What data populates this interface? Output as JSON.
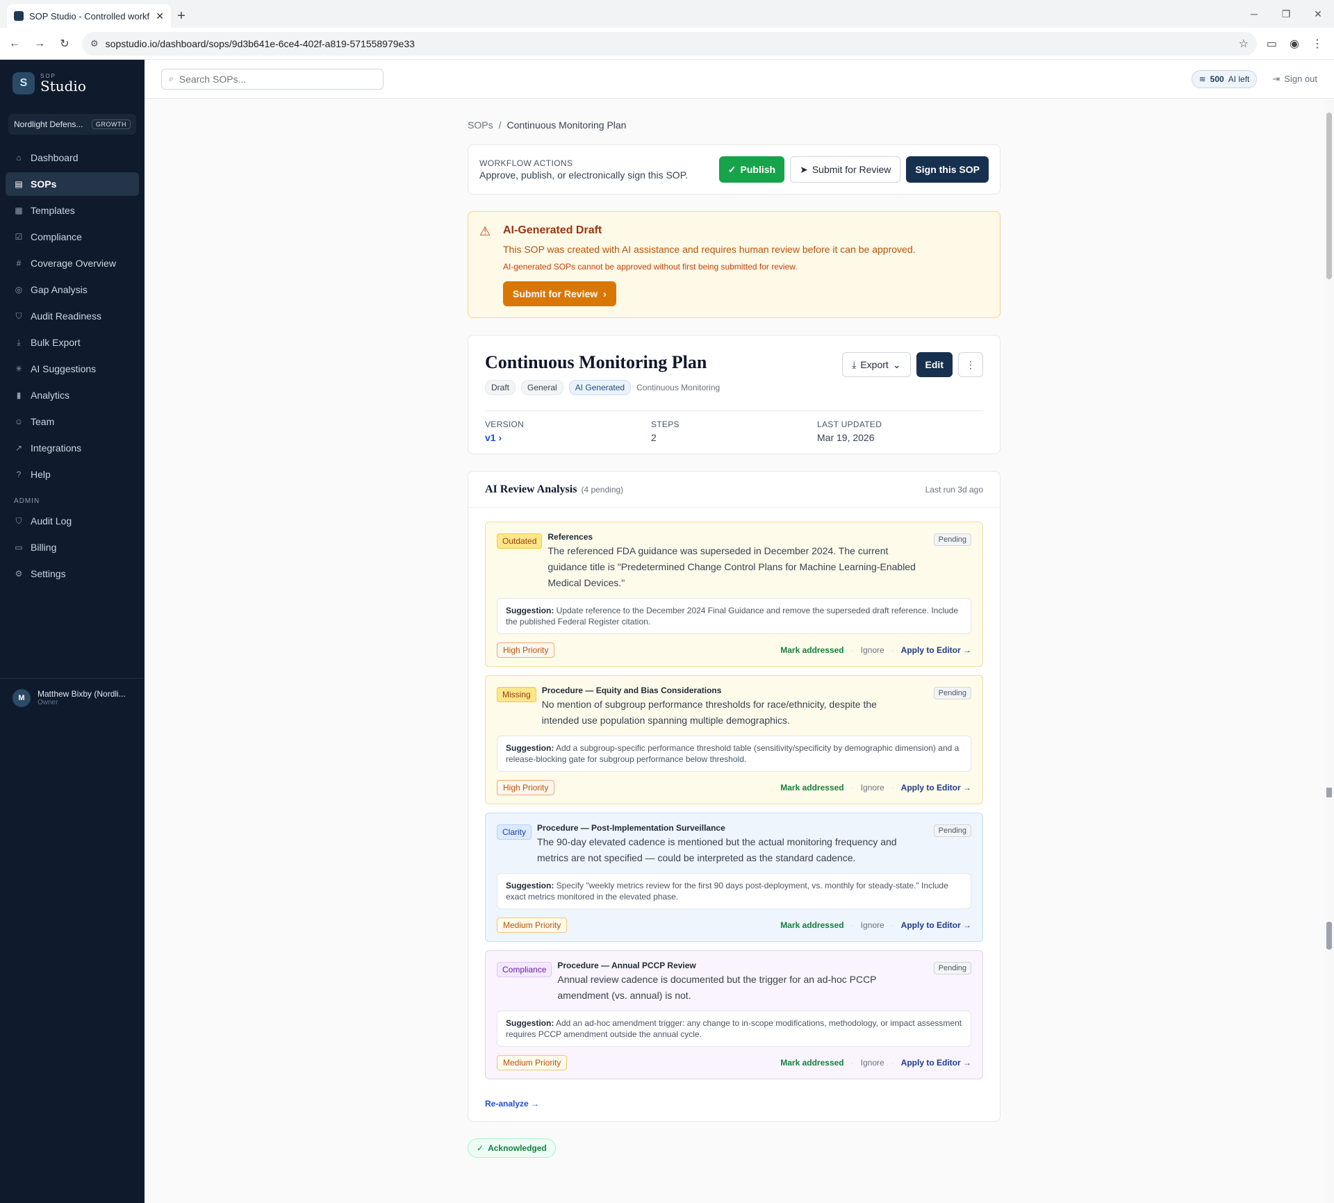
{
  "browser": {
    "tab_title": "SOP Studio - Controlled workflo",
    "url": "sopstudio.io/dashboard/sops/9d3b641e-6ce4-402f-a819-571558979e33"
  },
  "sidebar": {
    "brand_small": "SOP",
    "brand_name": "Studio",
    "org_name": "Nordlight Defens...",
    "org_plan": "GROWTH",
    "items": [
      {
        "label": "Dashboard",
        "icon": "home-icon"
      },
      {
        "label": "SOPs",
        "icon": "document-icon"
      },
      {
        "label": "Templates",
        "icon": "template-icon"
      },
      {
        "label": "Compliance",
        "icon": "check-square-icon"
      },
      {
        "label": "Coverage Overview",
        "icon": "grid-icon"
      },
      {
        "label": "Gap Analysis",
        "icon": "target-icon"
      },
      {
        "label": "Audit Readiness",
        "icon": "shield-icon"
      },
      {
        "label": "Bulk Export",
        "icon": "download-icon"
      },
      {
        "label": "AI Suggestions",
        "icon": "sparkle-icon"
      },
      {
        "label": "Analytics",
        "icon": "bar-chart-icon"
      },
      {
        "label": "Team",
        "icon": "users-icon"
      },
      {
        "label": "Integrations",
        "icon": "external-link-icon"
      },
      {
        "label": "Help",
        "icon": "help-circle-icon"
      }
    ],
    "admin_label": "ADMIN",
    "admin_items": [
      {
        "label": "Audit Log",
        "icon": "shield-icon"
      },
      {
        "label": "Billing",
        "icon": "credit-card-icon"
      },
      {
        "label": "Settings",
        "icon": "gear-icon"
      }
    ],
    "user_initial": "M",
    "user_name": "Matthew Bixby (Nordli...",
    "user_role": "Owner"
  },
  "topbar": {
    "search_placeholder": "Search SOPs...",
    "ai_left_count": "500",
    "ai_left_label": "AI left",
    "signout": "Sign out"
  },
  "breadcrumb": {
    "root": "SOPs",
    "sep": "/",
    "current": "Continuous Monitoring Plan"
  },
  "workflow": {
    "title": "WORKFLOW ACTIONS",
    "subtitle": "Approve, publish, or electronically sign this SOP.",
    "publish": "Publish",
    "submit": "Submit for Review",
    "sign": "Sign this SOP"
  },
  "ai_banner": {
    "title": "AI-Generated Draft",
    "text": "This SOP was created with AI assistance and requires human review before it can be approved.",
    "note": "AI-generated SOPs cannot be approved without first being submitted for review.",
    "button": "Submit for Review"
  },
  "sop": {
    "title": "Continuous Monitoring Plan",
    "tags": [
      "Draft",
      "General",
      "AI Generated"
    ],
    "category": "Continuous Monitoring",
    "export": "Export",
    "edit": "Edit",
    "version_label": "VERSION",
    "version_value": "v1",
    "steps_label": "STEPS",
    "steps_value": "2",
    "updated_label": "LAST UPDATED",
    "updated_value": "Mar 19, 2026"
  },
  "review": {
    "title": "AI Review Analysis",
    "pending_count": "(4 pending)",
    "last_run": "Last run 3d ago",
    "issues": [
      {
        "kind": "Outdated",
        "section": "References",
        "text": "The referenced FDA guidance was superseded in December 2024. The current guidance title is \"Predetermined Change Control Plans for Machine Learning-Enabled Medical Devices.\"",
        "status": "Pending",
        "suggestion_label": "Suggestion:",
        "suggestion": "Update reference to the December 2024 Final Guidance and remove the superseded draft reference. Include the published Federal Register citation.",
        "priority": "High Priority"
      },
      {
        "kind": "Missing",
        "section": "Procedure — Equity and Bias Considerations",
        "text": "No mention of subgroup performance thresholds for race/ethnicity, despite the intended use population spanning multiple demographics.",
        "status": "Pending",
        "suggestion_label": "Suggestion:",
        "suggestion": "Add a subgroup-specific performance threshold table (sensitivity/specificity by demographic dimension) and a release-blocking gate for subgroup performance below threshold.",
        "priority": "High Priority"
      },
      {
        "kind": "Clarity",
        "section": "Procedure — Post-Implementation Surveillance",
        "text": "The 90-day elevated cadence is mentioned but the actual monitoring frequency and metrics are not specified — could be interpreted as the standard cadence.",
        "status": "Pending",
        "suggestion_label": "Suggestion:",
        "suggestion": "Specify \"weekly metrics review for the first 90 days post-deployment, vs. monthly for steady-state.\" Include exact metrics monitored in the elevated phase.",
        "priority": "Medium Priority"
      },
      {
        "kind": "Compliance",
        "section": "Procedure — Annual PCCP Review",
        "text": "Annual review cadence is documented but the trigger for an ad-hoc PCCP amendment (vs. annual) is not.",
        "status": "Pending",
        "suggestion_label": "Suggestion:",
        "suggestion": "Add an ad-hoc amendment trigger: any change to in-scope modifications, methodology, or impact assessment requires PCCP amendment outside the annual cycle.",
        "priority": "Medium Priority"
      }
    ],
    "actions": {
      "mark": "Mark addressed",
      "ignore": "Ignore",
      "apply": "Apply to Editor →",
      "sep": "·"
    },
    "reanalyze": "Re-analyze →"
  },
  "acknowledged": "Acknowledged"
}
